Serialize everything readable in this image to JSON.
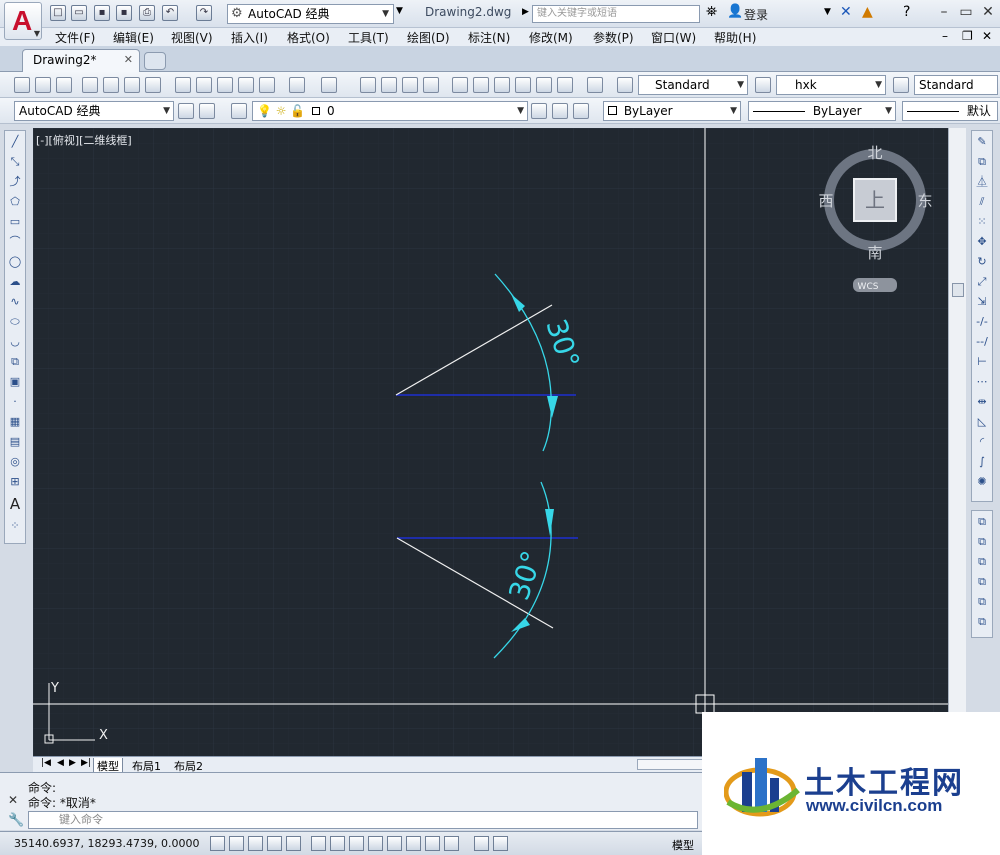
{
  "titlebar": {
    "logo_letter": "A",
    "workspace": "AutoCAD 经典",
    "doc_title": "Drawing2.dwg",
    "search_placeholder": "键入关键字或短语",
    "login": "登录"
  },
  "menu": [
    "文件(F)",
    "编辑(E)",
    "视图(V)",
    "插入(I)",
    "格式(O)",
    "工具(T)",
    "绘图(D)",
    "标注(N)",
    "修改(M)",
    "参数(P)",
    "窗口(W)",
    "帮助(H)"
  ],
  "tabs": {
    "active": "Drawing2*"
  },
  "toolbar1": {
    "text_style": "Standard",
    "dim_style": "hxk",
    "table_style": "Standard"
  },
  "toolbar2": {
    "workspace": "AutoCAD 经典",
    "layer": "0",
    "color": "ByLayer",
    "linetype": "ByLayer",
    "lineweight": "默认"
  },
  "viewport": {
    "label": "[-][俯视][二维线框]"
  },
  "viewcube": {
    "north": "北",
    "south": "南",
    "east": "东",
    "west": "西",
    "face": "上",
    "ucs": "WCS"
  },
  "drawing": {
    "dim_upper": "30°",
    "dim_lower": "30°",
    "ucs_x": "X",
    "ucs_y": "Y",
    "colors": {
      "background": "#212830",
      "dimension": "#37d7e8",
      "baseline": "#1e2fd0",
      "line": "#f0f0f0"
    }
  },
  "layout_tabs": [
    "模型",
    "布局1",
    "布局2"
  ],
  "command": {
    "line1": "命令:",
    "line2": "命令: *取消*",
    "input_placeholder": "键入命令"
  },
  "status": {
    "coords": "35140.6937, 18293.4739, 0.0000",
    "model": "模型"
  },
  "watermark": {
    "title": "土木工程网",
    "url": "www.civilcn.com"
  }
}
